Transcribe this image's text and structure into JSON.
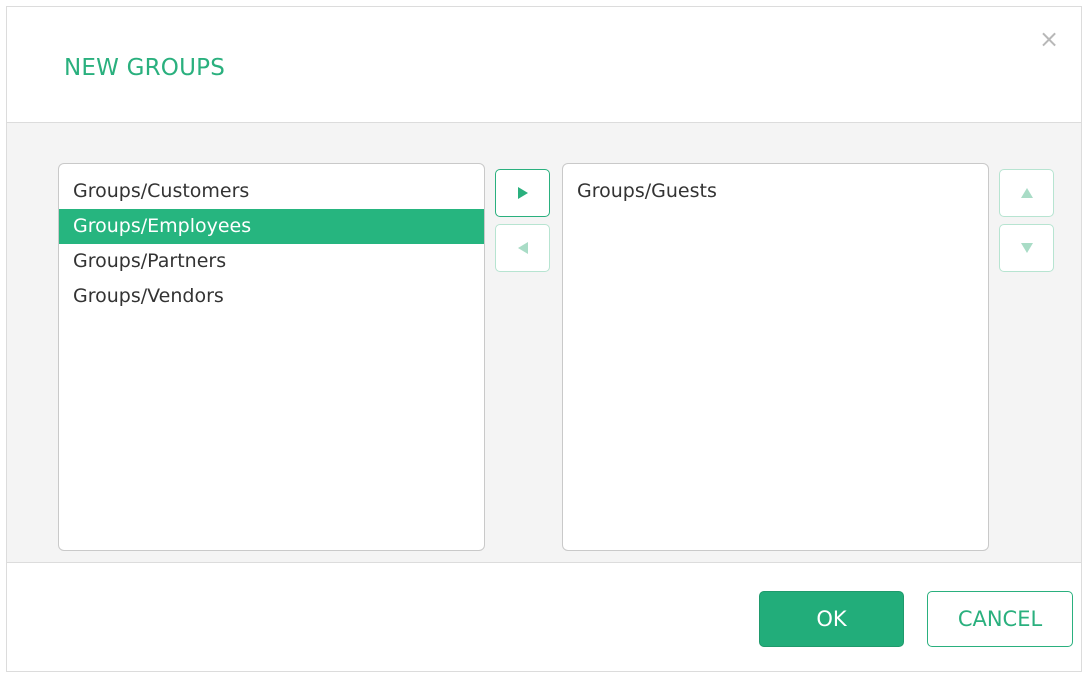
{
  "dialog": {
    "title": "NEW GROUPS",
    "close_icon": "close-icon",
    "close_glyph": "×"
  },
  "available_list": {
    "items": [
      {
        "label": "Groups/Customers",
        "selected": false
      },
      {
        "label": "Groups/Employees",
        "selected": true
      },
      {
        "label": "Groups/Partners",
        "selected": false
      },
      {
        "label": "Groups/Vendors",
        "selected": false
      }
    ]
  },
  "selected_list": {
    "items": [
      {
        "label": "Groups/Guests",
        "selected": false
      }
    ]
  },
  "controls": {
    "move_right_icon": "arrow-right-icon",
    "move_left_icon": "arrow-left-icon",
    "move_up_icon": "arrow-up-icon",
    "move_down_icon": "arrow-down-icon"
  },
  "footer": {
    "ok_label": "OK",
    "cancel_label": "CANCEL"
  },
  "colors": {
    "accent": "#2ab07e",
    "selection": "#26b57f",
    "disabled_accent": "#a9dcc6"
  }
}
